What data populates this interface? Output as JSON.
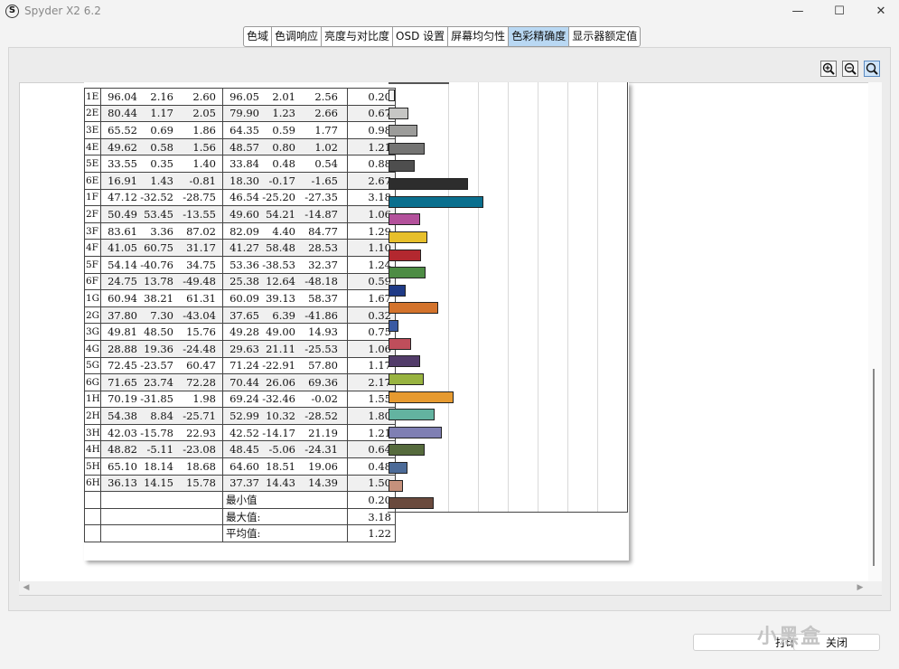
{
  "window": {
    "title": "Spyder X2 6.2",
    "app_icon": "S",
    "minimize": "—",
    "maximize": "☐",
    "close": "✕"
  },
  "tabs": [
    {
      "label": "色域",
      "active": false
    },
    {
      "label": "色调响应",
      "active": false
    },
    {
      "label": "亮度与对比度",
      "active": false
    },
    {
      "label": "OSD 设置",
      "active": false
    },
    {
      "label": "屏幕均匀性",
      "active": false
    },
    {
      "label": "色彩精确度",
      "active": true
    },
    {
      "label": "显示器额定值",
      "active": false
    }
  ],
  "zoom_tools": [
    "zoom-in-icon",
    "zoom-out-icon",
    "zoom-fit-icon"
  ],
  "rows": [
    {
      "id": "1E",
      "r": [
        "96.04",
        "2.16",
        "2.60"
      ],
      "m": [
        "96.05",
        "2.01",
        "2.56"
      ],
      "de": "0.20",
      "color": "#f4f4f4"
    },
    {
      "id": "2E",
      "r": [
        "80.44",
        "1.17",
        "2.05"
      ],
      "m": [
        "79.90",
        "1.23",
        "2.66"
      ],
      "de": "0.67",
      "color": "#c6c6c4"
    },
    {
      "id": "3E",
      "r": [
        "65.52",
        "0.69",
        "1.86"
      ],
      "m": [
        "64.35",
        "0.59",
        "1.77"
      ],
      "de": "0.98",
      "color": "#9c9c9a"
    },
    {
      "id": "4E",
      "r": [
        "49.62",
        "0.58",
        "1.56"
      ],
      "m": [
        "48.57",
        "0.80",
        "1.02"
      ],
      "de": "1.21",
      "color": "#747473"
    },
    {
      "id": "5E",
      "r": [
        "33.55",
        "0.35",
        "1.40"
      ],
      "m": [
        "33.84",
        "0.48",
        "0.54"
      ],
      "de": "0.88",
      "color": "#4e4e4e"
    },
    {
      "id": "6E",
      "r": [
        "16.91",
        "1.43",
        "-0.81"
      ],
      "m": [
        "18.30",
        "-0.17",
        "-1.65"
      ],
      "de": "2.67",
      "color": "#2d2d2d"
    },
    {
      "id": "1F",
      "r": [
        "47.12",
        "-32.52",
        "-28.75"
      ],
      "m": [
        "46.54",
        "-25.20",
        "-27.35"
      ],
      "de": "3.18",
      "color": "#0a6f8e"
    },
    {
      "id": "2F",
      "r": [
        "50.49",
        "53.45",
        "-13.55"
      ],
      "m": [
        "49.60",
        "54.21",
        "-14.87"
      ],
      "de": "1.06",
      "color": "#b3519b"
    },
    {
      "id": "3F",
      "r": [
        "83.61",
        "3.36",
        "87.02"
      ],
      "m": [
        "82.09",
        "4.40",
        "84.77"
      ],
      "de": "1.29",
      "color": "#e7bf2b"
    },
    {
      "id": "4F",
      "r": [
        "41.05",
        "60.75",
        "31.17"
      ],
      "m": [
        "41.27",
        "58.48",
        "28.53"
      ],
      "de": "1.10",
      "color": "#b3282f"
    },
    {
      "id": "5F",
      "r": [
        "54.14",
        "-40.76",
        "34.75"
      ],
      "m": [
        "53.36",
        "-38.53",
        "32.37"
      ],
      "de": "1.24",
      "color": "#4d8c44"
    },
    {
      "id": "6F",
      "r": [
        "24.75",
        "13.78",
        "-49.48"
      ],
      "m": [
        "25.38",
        "12.64",
        "-48.18"
      ],
      "de": "0.59",
      "color": "#1f3a86"
    },
    {
      "id": "1G",
      "r": [
        "60.94",
        "38.21",
        "61.31"
      ],
      "m": [
        "60.09",
        "39.13",
        "58.37"
      ],
      "de": "1.67",
      "color": "#d3732c"
    },
    {
      "id": "2G",
      "r": [
        "37.80",
        "7.30",
        "-43.04"
      ],
      "m": [
        "37.65",
        "6.39",
        "-41.86"
      ],
      "de": "0.32",
      "color": "#3a5aa3"
    },
    {
      "id": "3G",
      "r": [
        "49.81",
        "48.50",
        "15.76"
      ],
      "m": [
        "49.28",
        "49.00",
        "14.93"
      ],
      "de": "0.75",
      "color": "#bf4e5b"
    },
    {
      "id": "4G",
      "r": [
        "28.88",
        "19.36",
        "-24.48"
      ],
      "m": [
        "29.63",
        "21.11",
        "-25.53"
      ],
      "de": "1.06",
      "color": "#523c6a"
    },
    {
      "id": "5G",
      "r": [
        "72.45",
        "-23.57",
        "60.47"
      ],
      "m": [
        "71.24",
        "-22.91",
        "57.80"
      ],
      "de": "1.17",
      "color": "#98b340"
    },
    {
      "id": "6G",
      "r": [
        "71.65",
        "23.74",
        "72.28"
      ],
      "m": [
        "70.44",
        "26.06",
        "69.36"
      ],
      "de": "2.17",
      "color": "#e69a30"
    },
    {
      "id": "1H",
      "r": [
        "70.19",
        "-31.85",
        "1.98"
      ],
      "m": [
        "69.24",
        "-32.46",
        "-0.02"
      ],
      "de": "1.55",
      "color": "#63b3a0"
    },
    {
      "id": "2H",
      "r": [
        "54.38",
        "8.84",
        "-25.71"
      ],
      "m": [
        "52.99",
        "10.32",
        "-28.52"
      ],
      "de": "1.80",
      "color": "#7f7fb3"
    },
    {
      "id": "3H",
      "r": [
        "42.03",
        "-15.78",
        "22.93"
      ],
      "m": [
        "42.52",
        "-14.17",
        "21.19"
      ],
      "de": "1.21",
      "color": "#566b3d"
    },
    {
      "id": "4H",
      "r": [
        "48.82",
        "-5.11",
        "-23.08"
      ],
      "m": [
        "48.45",
        "-5.06",
        "-24.31"
      ],
      "de": "0.64",
      "color": "#4c6b98"
    },
    {
      "id": "5H",
      "r": [
        "65.10",
        "18.14",
        "18.68"
      ],
      "m": [
        "64.60",
        "18.51",
        "19.06"
      ],
      "de": "0.48",
      "color": "#c6917c"
    },
    {
      "id": "6H",
      "r": [
        "36.13",
        "14.15",
        "15.78"
      ],
      "m": [
        "37.37",
        "14.43",
        "14.39"
      ],
      "de": "1.50",
      "color": "#6a4a3d"
    }
  ],
  "summary": [
    {
      "label": "最小值",
      "value": "0.20"
    },
    {
      "label": "最大值:",
      "value": "3.18"
    },
    {
      "label": "平均值:",
      "value": "1.22"
    }
  ],
  "bar_scale_max": 3.18,
  "buttons": {
    "print": "打印",
    "close": "关闭"
  },
  "watermark": "小黑盒"
}
